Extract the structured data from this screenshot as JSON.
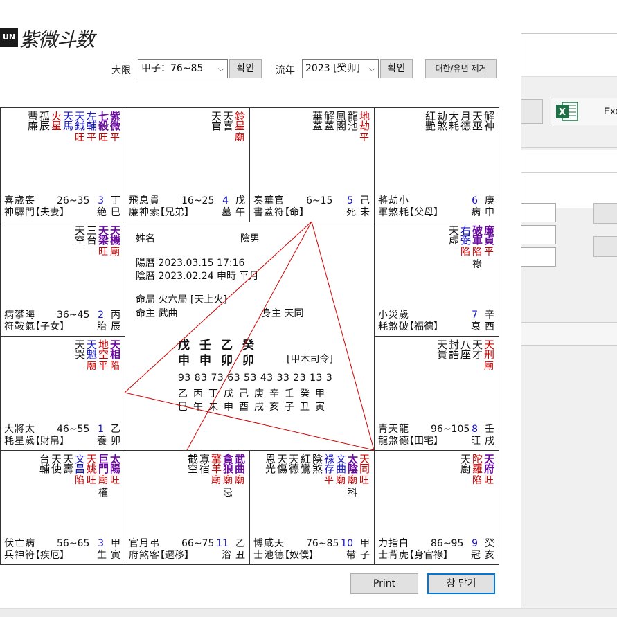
{
  "logo": {
    "box": "UN",
    "text": "紫微斗数"
  },
  "controls": {
    "daehan_label": "大限",
    "daehan_value": "甲子：76~85",
    "confirm1": "확인",
    "yunyear_label": "流年",
    "yunyear_value": "2023 [癸卯]",
    "confirm2": "확인",
    "clear_button": "대한/유년 제거"
  },
  "bg_window": {
    "excel_label": "Exc"
  },
  "center": {
    "name_label": "姓名",
    "gender": "陰男",
    "solar": "陽曆  2023.03.15 17:16",
    "lunar": "陰曆  2023.02.24 申時 平月",
    "ming_ju": "命局  火六局 [天上火]",
    "ming_zhu": "命主  武曲",
    "shen_zhu": "身主    天同",
    "pillars_top": "戊壬乙癸",
    "pillars_bottom": "申申卯卯",
    "siling": "[甲木司令]",
    "dae_ages": "93 83 73 63 53 43 33 23 13 3",
    "dae_stems": "乙丙丁戊己庚辛壬癸甲",
    "dae_branches": "巳午未申酉戌亥子丑寅"
  },
  "palaces": [
    {
      "id": "spouse",
      "stars": [
        {
          "name": "紫微",
          "cls": "c-main",
          "status": "平"
        },
        {
          "name": "七殺",
          "cls": "c-main",
          "status": "旺"
        },
        {
          "name": "左輔",
          "cls": "c-blue",
          "status": "平"
        },
        {
          "name": "天鉞",
          "cls": "c-blue",
          "status": "旺"
        },
        {
          "name": "天馬",
          "cls": "c-blue",
          "status": ""
        },
        {
          "name": "火星",
          "cls": "c-red",
          "status": ""
        },
        {
          "name": "孤辰",
          "cls": "c-black",
          "status": ""
        },
        {
          "name": "蜚廉",
          "cls": "c-black",
          "status": ""
        }
      ],
      "minor_top": "喜歲喪",
      "minor_bottom": "神驛門",
      "ages": "26~35",
      "num": "3",
      "palace": "【夫妻】",
      "stem": "丁",
      "branch": "巳",
      "life": "絶"
    },
    {
      "id": "brother",
      "stars": [
        {
          "name": "鈴星",
          "cls": "c-red",
          "status": "廟"
        },
        {
          "name": "天喜",
          "cls": "c-black",
          "status": ""
        },
        {
          "name": "天官",
          "cls": "c-black",
          "status": ""
        }
      ],
      "minor_top": "飛息貫",
      "minor_bottom": "廉神索",
      "ages": "16~25",
      "num": "4",
      "palace": "【兄弟】",
      "stem": "戊",
      "branch": "午",
      "life": "墓"
    },
    {
      "id": "life",
      "stars": [
        {
          "name": "地劫",
          "cls": "c-red",
          "status": "平"
        },
        {
          "name": "龍池",
          "cls": "c-black",
          "status": ""
        },
        {
          "name": "鳳閣",
          "cls": "c-black",
          "status": ""
        },
        {
          "name": "解蓋",
          "cls": "c-black",
          "status": ""
        },
        {
          "name": "華蓋",
          "cls": "c-black",
          "status": ""
        }
      ],
      "minor_top": "奏華官",
      "minor_bottom": "書蓋符",
      "ages": "6~15",
      "num": "5",
      "palace": "【命】",
      "stem": "己",
      "branch": "未",
      "life": "死"
    },
    {
      "id": "parents",
      "stars": [
        {
          "name": "解神",
          "cls": "c-black",
          "status": ""
        },
        {
          "name": "天巫",
          "cls": "c-black",
          "status": ""
        },
        {
          "name": "月德",
          "cls": "c-black",
          "status": ""
        },
        {
          "name": "大耗",
          "cls": "c-black",
          "status": ""
        },
        {
          "name": "劫煞",
          "cls": "c-black",
          "status": ""
        },
        {
          "name": "紅艷",
          "cls": "c-black",
          "status": ""
        }
      ],
      "minor_top": "將劫小",
      "minor_bottom": "軍煞耗",
      "ages": "",
      "num": "6",
      "palace": "【父母】",
      "stem": "庚",
      "branch": "申",
      "life": "病"
    },
    {
      "id": "children",
      "stars": [
        {
          "name": "天機",
          "cls": "c-main",
          "status": "廟"
        },
        {
          "name": "天梁",
          "cls": "c-main",
          "status": "旺"
        },
        {
          "name": "三台",
          "cls": "c-black",
          "status": ""
        },
        {
          "name": "天空",
          "cls": "c-black",
          "status": ""
        }
      ],
      "minor_top": "病攀晦",
      "minor_bottom": "符鞍氣",
      "ages": "36~45",
      "num": "2",
      "palace": "【子女】",
      "stem": "丙",
      "branch": "辰",
      "life": "胎"
    },
    {
      "id": "fortune",
      "stars": [
        {
          "name": "廉貞",
          "cls": "c-main",
          "status": "平",
          "hw": ""
        },
        {
          "name": "破軍",
          "cls": "c-main",
          "status": "陷",
          "hw": "祿"
        },
        {
          "name": "右弼",
          "cls": "c-blue",
          "status": "陷"
        },
        {
          "name": "天虛",
          "cls": "c-black",
          "status": ""
        }
      ],
      "minor_top": "小災歲",
      "minor_bottom": "耗煞破",
      "ages": "",
      "num": "7",
      "palace": "【福德】",
      "stem": "辛",
      "branch": "酉",
      "life": "衰"
    },
    {
      "id": "wealth",
      "stars": [
        {
          "name": "天相",
          "cls": "c-main",
          "status": "陷"
        },
        {
          "name": "地空",
          "cls": "c-red",
          "status": "平"
        },
        {
          "name": "天魁",
          "cls": "c-blue",
          "status": "廟"
        },
        {
          "name": "天哭",
          "cls": "c-black",
          "status": ""
        }
      ],
      "minor_top": "大將太",
      "minor_bottom": "耗星歲",
      "ages": "46~55",
      "num": "1",
      "palace": "【財帛】",
      "stem": "乙",
      "branch": "卯",
      "life": "養"
    },
    {
      "id": "property",
      "stars": [
        {
          "name": "天刑",
          "cls": "c-red",
          "status": "廟"
        },
        {
          "name": "天才",
          "cls": "c-black",
          "status": ""
        },
        {
          "name": "八座",
          "cls": "c-black",
          "status": ""
        },
        {
          "name": "封誥",
          "cls": "c-black",
          "status": ""
        },
        {
          "name": "天貴",
          "cls": "c-black",
          "status": ""
        }
      ],
      "minor_top": "青天龍",
      "minor_bottom": "龍煞德",
      "ages": "96~105",
      "num": "8",
      "palace": "【田宅】",
      "stem": "壬",
      "branch": "戌",
      "life": "旺"
    },
    {
      "id": "illness",
      "stars": [
        {
          "name": "太陽",
          "cls": "c-main",
          "status": "旺",
          "hw": ""
        },
        {
          "name": "巨門",
          "cls": "c-main",
          "status": "廟",
          "hw": "權"
        },
        {
          "name": "天姚",
          "cls": "c-red",
          "status": "旺"
        },
        {
          "name": "文昌",
          "cls": "c-blue",
          "status": "陷"
        },
        {
          "name": "天壽",
          "cls": "c-black",
          "status": ""
        },
        {
          "name": "天使",
          "cls": "c-black",
          "status": ""
        },
        {
          "name": "台輔",
          "cls": "c-black",
          "status": ""
        }
      ],
      "minor_top": "伏亡病",
      "minor_bottom": "兵神符",
      "ages": "56~65",
      "num": "3",
      "palace": "【疾厄】",
      "stem": "甲",
      "branch": "寅",
      "life": "生"
    },
    {
      "id": "travel",
      "stars": [
        {
          "name": "武曲",
          "cls": "c-main",
          "status": "廟",
          "hw": ""
        },
        {
          "name": "貪狼",
          "cls": "c-main",
          "status": "廟",
          "hw": "忌"
        },
        {
          "name": "擎羊",
          "cls": "c-red",
          "status": "廟"
        },
        {
          "name": "寡宿",
          "cls": "c-black",
          "status": ""
        },
        {
          "name": "截空",
          "cls": "c-black",
          "status": ""
        }
      ],
      "minor_top": "官月弔",
      "minor_bottom": "府煞客",
      "ages": "66~75",
      "num": "11",
      "palace": "【遷移】",
      "stem": "乙",
      "branch": "丑",
      "life": "浴"
    },
    {
      "id": "servant",
      "stars": [
        {
          "name": "天同",
          "cls": "c-red",
          "status": "旺",
          "hw": ""
        },
        {
          "name": "太陰",
          "cls": "c-main",
          "status": "廟",
          "hw": "科"
        },
        {
          "name": "文曲",
          "cls": "c-blue",
          "status": "廟"
        },
        {
          "name": "祿存",
          "cls": "c-blue",
          "status": "平"
        },
        {
          "name": "陰煞",
          "cls": "c-black",
          "status": ""
        },
        {
          "name": "紅鸞",
          "cls": "c-black",
          "status": ""
        },
        {
          "name": "天德",
          "cls": "c-black",
          "status": ""
        },
        {
          "name": "天傷",
          "cls": "c-black",
          "status": ""
        },
        {
          "name": "恩光",
          "cls": "c-black",
          "status": ""
        }
      ],
      "minor_top": "博咸天",
      "minor_bottom": "士池德",
      "ages": "76~85",
      "num": "10",
      "palace": "【奴僕】",
      "stem": "甲",
      "branch": "子",
      "life": "帶"
    },
    {
      "id": "career",
      "stars": [
        {
          "name": "天府",
          "cls": "c-main",
          "status": "旺"
        },
        {
          "name": "陀羅",
          "cls": "c-red",
          "status": "陷"
        },
        {
          "name": "天廚",
          "cls": "c-black",
          "status": ""
        }
      ],
      "minor_top": "力指白",
      "minor_bottom": "士背虎",
      "ages": "86~95",
      "num": "9",
      "palace": "【身官祿】",
      "stem": "癸",
      "branch": "亥",
      "life": "冠"
    }
  ],
  "footer": {
    "print": "Print",
    "close": "창 닫기"
  }
}
